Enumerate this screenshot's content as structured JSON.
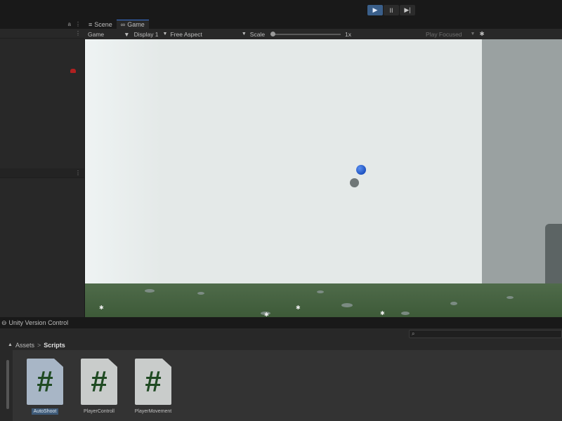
{
  "toolbar": {
    "play_icon": "play-icon",
    "pause_icon": "pause-icon",
    "step_icon": "step-icon",
    "play_glyph": "▶",
    "pause_glyph": "II",
    "step_glyph": "▶|"
  },
  "left_panel": {
    "lock_glyph": "a",
    "menu_glyph": "⋮"
  },
  "view": {
    "tabs": [
      {
        "label": "Scene",
        "glyph": "≡"
      },
      {
        "label": "Game",
        "glyph": "∞"
      }
    ],
    "bar": {
      "mode": "Game",
      "display": "Display 1",
      "aspect": "Free Aspect",
      "scale_label": "Scale",
      "scale_value": "1x",
      "play_mode": "Play Focused"
    }
  },
  "bottom": {
    "tab_label": "Unity Version Control",
    "search_glyph": "🔍",
    "breadcrumb": {
      "root": "Assets",
      "sep": ">",
      "current": "Scripts"
    },
    "assets": [
      {
        "name": "AutoShoot",
        "selected": true
      },
      {
        "name": "PlayerControll",
        "selected": false
      },
      {
        "name": "PlayerMovement",
        "selected": false
      }
    ],
    "file_glyph": "#"
  },
  "colors": {
    "accent": "#3b75d8",
    "selection": "#3e5a78",
    "sky": "#e4e9e8",
    "ground": "#4f6b4a"
  }
}
